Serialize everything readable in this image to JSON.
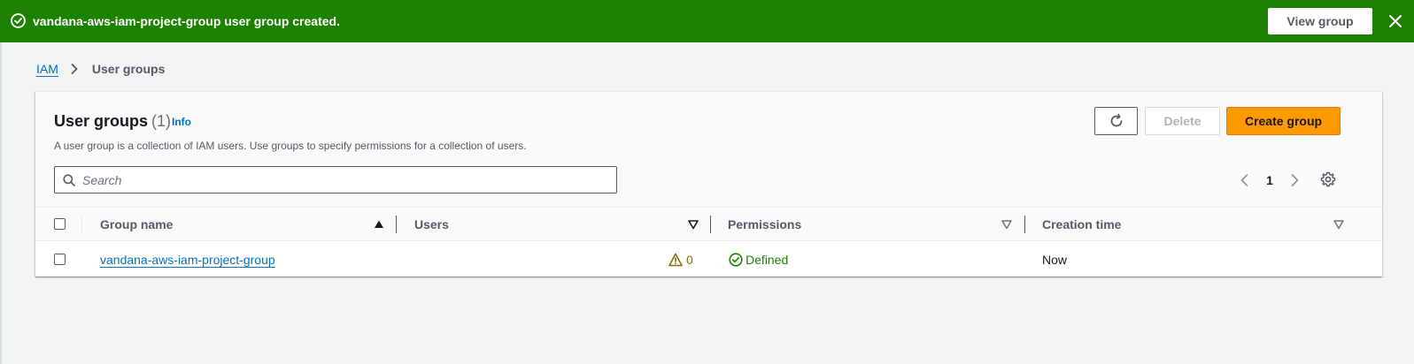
{
  "flash": {
    "message": "vandana-aws-iam-project-group user group created.",
    "view_button": "View group",
    "color": "#1d8102"
  },
  "breadcrumb": {
    "root": "IAM",
    "current": "User groups"
  },
  "panel": {
    "title": "User groups",
    "count": "(1)",
    "info": "Info",
    "description": "A user group is a collection of IAM users. Use groups to specify permissions for a collection of users.",
    "delete_label": "Delete",
    "create_label": "Create group"
  },
  "search": {
    "placeholder": "Search",
    "value": ""
  },
  "pagination": {
    "current_page": "1"
  },
  "table": {
    "columns": [
      "Group name",
      "Users",
      "Permissions",
      "Creation time"
    ],
    "rows": [
      {
        "group_name": "vandana-aws-iam-project-group",
        "users": "0",
        "permissions": "Defined",
        "creation_time": "Now"
      }
    ]
  },
  "colors": {
    "accent": "#ff9900",
    "link": "#0073bb",
    "success": "#1d8102",
    "warning": "#8a6b05"
  }
}
